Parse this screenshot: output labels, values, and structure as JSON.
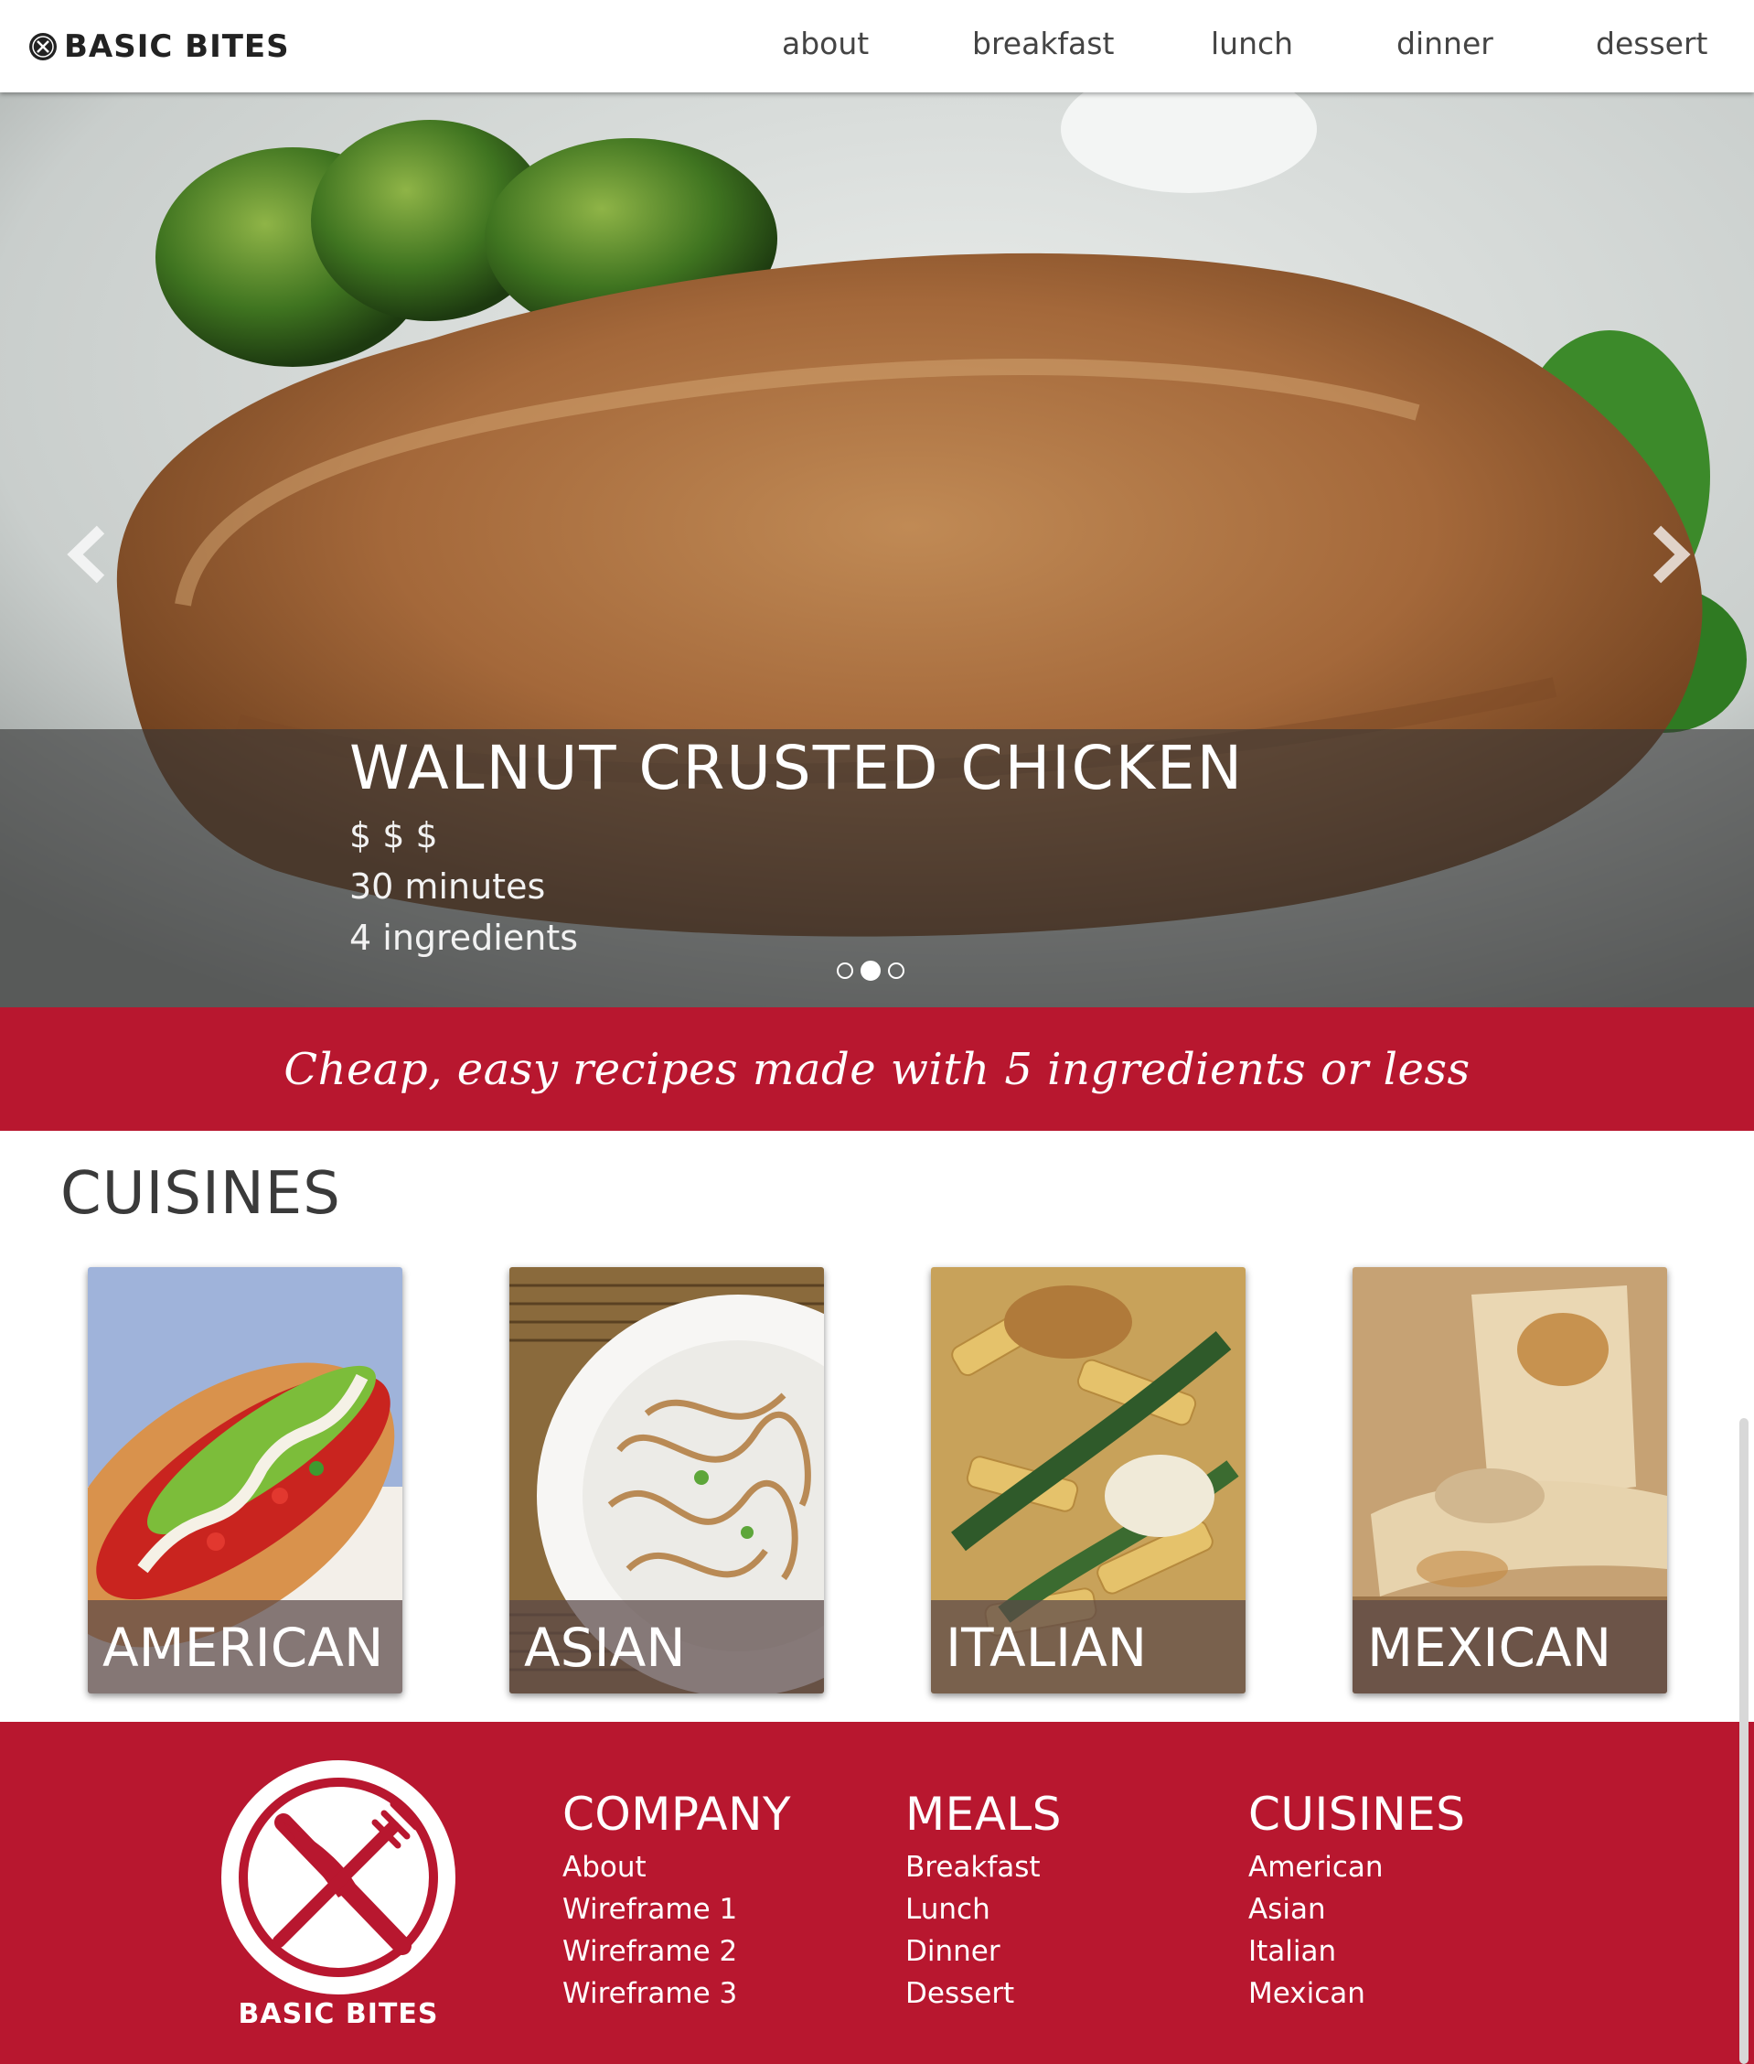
{
  "header": {
    "brand": "BASIC BITES",
    "nav": [
      "about",
      "breakfast",
      "lunch",
      "dinner",
      "dessert"
    ]
  },
  "hero": {
    "title": "WALNUT CRUSTED CHICKEN",
    "price": "$ $ $",
    "time": "30 minutes",
    "ingredients": "4 ingredients",
    "slides": 3,
    "active_slide": 2
  },
  "tagline": "Cheap, easy recipes made with 5 ingredients or less",
  "cuisines": {
    "title": "CUISINES",
    "cards": [
      "AMERICAN",
      "ASIAN",
      "ITALIAN",
      "MEXICAN"
    ]
  },
  "footer": {
    "logo_text": "BASIC BITES",
    "columns": [
      {
        "heading": "COMPANY",
        "links": [
          "About",
          "Wireframe 1",
          "Wireframe 2",
          "Wireframe 3"
        ]
      },
      {
        "heading": "MEALS",
        "links": [
          "Breakfast",
          "Lunch",
          "Dinner",
          "Dessert"
        ]
      },
      {
        "heading": "CUISINES",
        "links": [
          "American",
          "Asian",
          "Italian",
          "Mexican"
        ]
      }
    ]
  },
  "colors": {
    "brand_red": "#b8172f",
    "header_bg": "#ffffff",
    "caption_overlay": "#373737"
  }
}
